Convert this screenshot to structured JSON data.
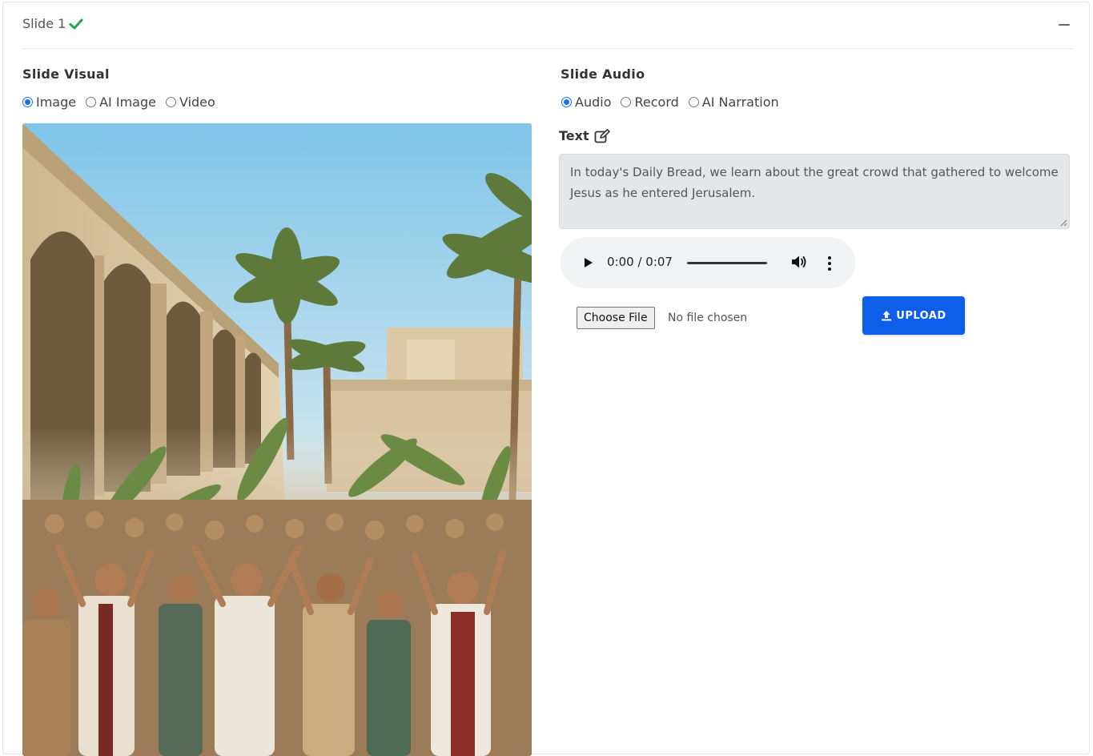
{
  "header": {
    "title": "Slide 1"
  },
  "visual": {
    "title": "Slide Visual",
    "options": [
      {
        "label": "Image",
        "checked": true
      },
      {
        "label": "AI Image",
        "checked": false
      },
      {
        "label": "Video",
        "checked": false
      }
    ],
    "image_description": "Illustration of a crowd waving palm branches beside stone arches in Jerusalem"
  },
  "audio": {
    "title": "Slide Audio",
    "options": [
      {
        "label": "Audio",
        "checked": true
      },
      {
        "label": "Record",
        "checked": false
      },
      {
        "label": "AI Narration",
        "checked": false
      }
    ],
    "text_label": "Text",
    "text_value": "In today's Daily Bread, we learn about the great crowd that gathered to welcome Jesus as he entered Jerusalem.",
    "player": {
      "time": "0:00 / 0:07"
    },
    "file": {
      "choose_label": "Choose File",
      "status": "No file chosen"
    },
    "upload_label": "UPLOAD"
  },
  "colors": {
    "accent": "#0d5ee8",
    "check": "#28a745",
    "radio": "#1a73e8"
  }
}
